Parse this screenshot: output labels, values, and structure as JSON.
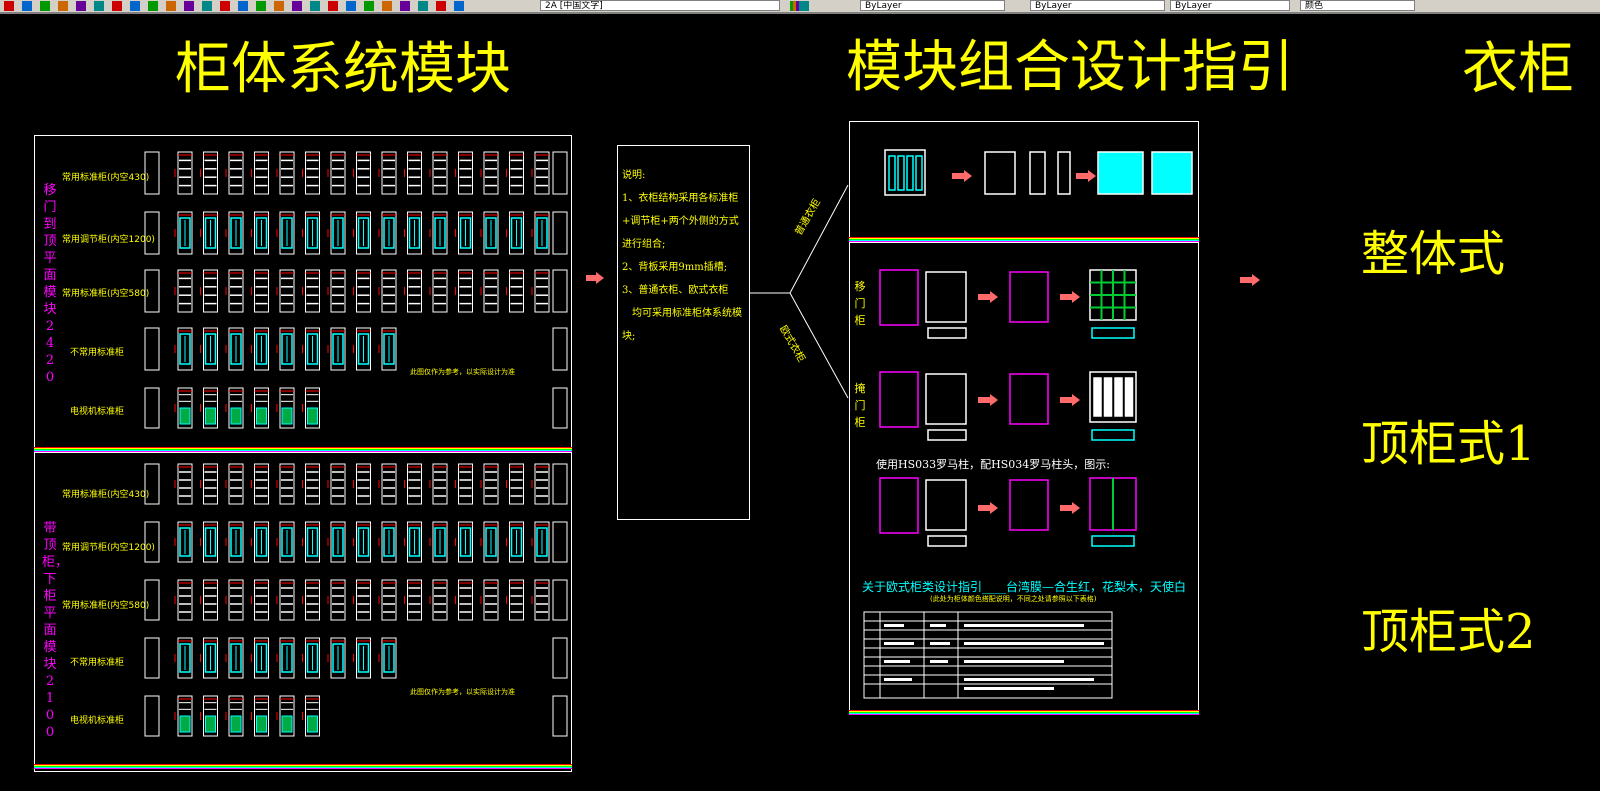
{
  "toolbar": {
    "text_style_field": "2A [中国文字]",
    "layer_fields": [
      "ByLayer",
      "ByLayer",
      "ByLayer"
    ],
    "color_field": "颜色"
  },
  "titles": {
    "left": "柜体系统模块",
    "middle": "模块组合设计指引",
    "right": "衣柜"
  },
  "panel_top": {
    "side_label": "移门到顶平面模块2420",
    "rows": [
      "常用标准柜(内空430)",
      "常用调节柜(内空1200)",
      "常用标准柜(内空580)",
      "不常用标准柜",
      "电视机标准柜"
    ],
    "hint": "此图仅作为参考，以实际设计为准"
  },
  "panel_bottom": {
    "side_label": "带顶柜，下柜平面模块2100",
    "rows": [
      "常用标准柜(内空430)",
      "常用调节柜(内空1200)",
      "常用标准柜(内空580)",
      "不常用标准柜",
      "电视机标准柜"
    ],
    "hint": "此图仅作为参考，以实际设计为准"
  },
  "notes": {
    "lines": [
      "说明:",
      "1、衣柜结构采用各标准柜",
      "+调节柜+两个外侧的方式",
      "进行组合;",
      "2、背板采用9mm插槽;",
      "3、普通衣柜、欧式衣柜",
      "　均可采用标准柜体系统模",
      "块;"
    ]
  },
  "branches": {
    "upper": "普通衣柜",
    "lower": "欧式衣柜"
  },
  "guide": {
    "side_1": "移门柜",
    "side_2": "掩门柜",
    "column_note": "使用HS033罗马柱，配HS034罗马柱头，图示:",
    "euro_title": "关于欧式柜类设计指引____台湾膜—合生红，花梨木，天使白",
    "euro_sub": "(此处为柜体颜色搭配说明，不同之处请参照以下表格)"
  },
  "right_labels": [
    "整体式",
    "顶柜式1",
    "顶柜式2"
  ],
  "colors": {
    "title": "#ffff00",
    "magenta": "#ff00ff",
    "cyan": "#00ffff",
    "red": "#ff0000",
    "arrow": "#ff6b6b",
    "frame": "#ffffff"
  }
}
